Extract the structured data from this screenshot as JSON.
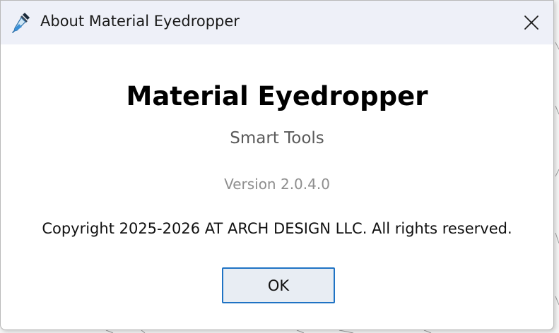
{
  "window": {
    "title": "About Material Eyedropper",
    "icon": "eyedropper-icon",
    "close_icon": "close-icon"
  },
  "about": {
    "app_name": "Material Eyedropper",
    "subtitle": "Smart Tools",
    "version": "Version 2.0.4.0",
    "copyright": "Copyright 2025-2026 AT ARCH DESIGN LLC. All rights reserved."
  },
  "buttons": {
    "ok_label": "OK"
  },
  "colors": {
    "titlebar_bg": "#eef0f8",
    "button_border": "#1f73c4",
    "button_bg": "#e8edf3",
    "subtitle": "#5a5a5a",
    "version": "#8e8e8e"
  }
}
